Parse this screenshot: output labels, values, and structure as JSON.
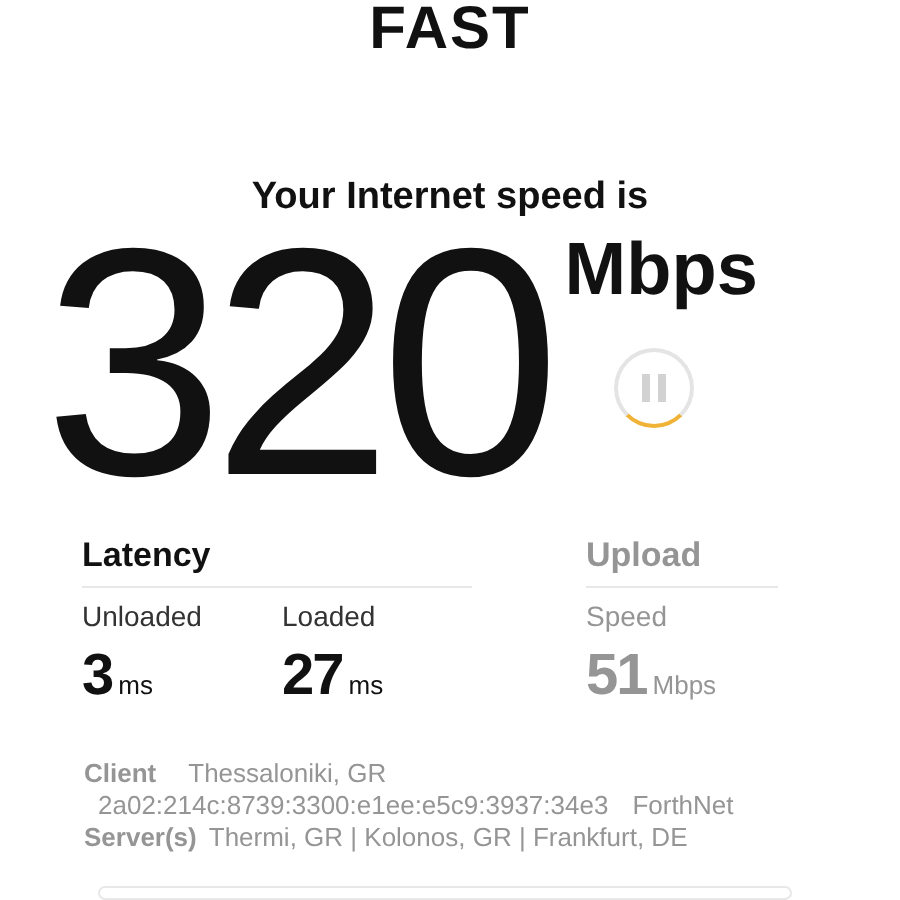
{
  "logo": "FAST",
  "headline": "Your Internet speed is",
  "speed": {
    "value": "320",
    "unit": "Mbps"
  },
  "sections": [
    {
      "title": "Latency",
      "dimmed": false,
      "metrics": [
        {
          "label": "Unloaded",
          "value": "3",
          "unit": "ms"
        },
        {
          "label": "Loaded",
          "value": "27",
          "unit": "ms"
        }
      ]
    },
    {
      "title": "Upload",
      "dimmed": true,
      "metrics": [
        {
          "label": "Speed",
          "value": "51",
          "unit": "Mbps"
        }
      ]
    }
  ],
  "client": {
    "label": "Client",
    "location": "Thessaloniki, GR",
    "ip": "2a02:214c:8739:3300:e1ee:e5c9:3937:34e3",
    "isp": "ForthNet"
  },
  "servers": {
    "label": "Server(s)",
    "list": "Thermi, GR  |  Kolonos, GR  |  Frankfurt, DE"
  }
}
